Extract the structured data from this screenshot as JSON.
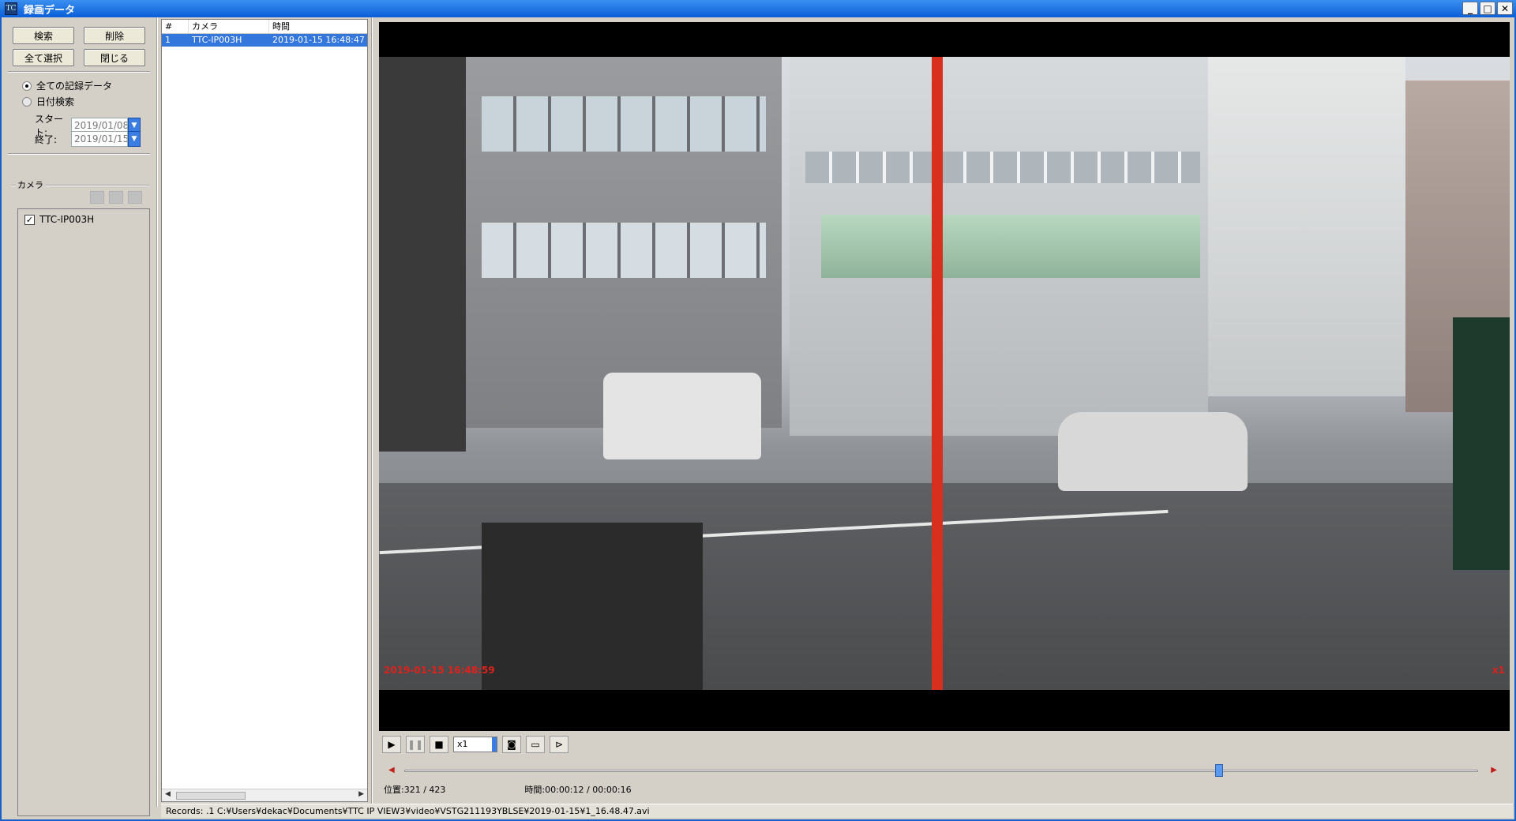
{
  "window": {
    "title": "録画データ",
    "icon_letters": "TC"
  },
  "toolbar": {
    "search_label": "検索",
    "delete_label": "削除",
    "select_all_label": "全て選択",
    "close_label": "閉じる"
  },
  "filter": {
    "all_records_label": "全ての記録データ",
    "date_search_label": "日付検索",
    "start_label": "スタート:",
    "start_value": "2019/01/08",
    "end_label": "終了:",
    "end_value": "2019/01/15",
    "selected": "all"
  },
  "camera": {
    "group_label": "カメラ",
    "items": [
      {
        "name": "TTC-IP003H",
        "checked": true
      }
    ]
  },
  "records": {
    "columns": [
      "#",
      "カメラ",
      "時間"
    ],
    "rows": [
      {
        "num": "1",
        "camera": "TTC-IP003H",
        "time": "2019-01-15 16:48:47"
      }
    ]
  },
  "video": {
    "osd_time": "2019-01-15 16:48:59",
    "osd_speed": "x1"
  },
  "playback": {
    "speed": "x1",
    "position_label": "位置:321 / 423",
    "time_label": "時間:00:00:12 / 00:00:16",
    "position_current": 321,
    "position_total": 423
  },
  "status": {
    "text": "Records: .1   C:¥Users¥dekac¥Documents¥TTC IP VIEW3¥video¥VSTG211193YBLSE¥2019-01-15¥1_16.48.47.avi"
  },
  "colors": {
    "titlebar": "#0a5fd8",
    "selection": "#3377dd",
    "osd": "#e0201a"
  }
}
